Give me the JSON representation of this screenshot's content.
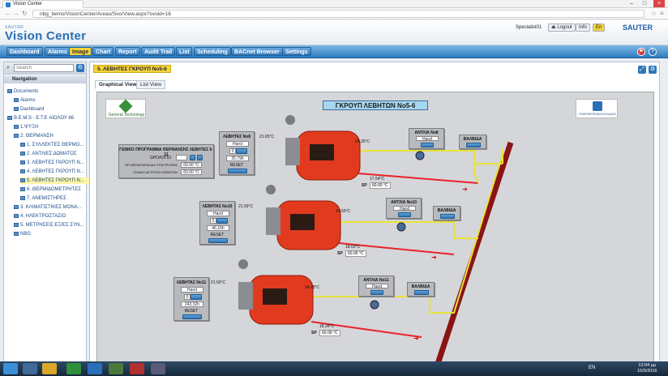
{
  "browser": {
    "tab_title": "Vision Center",
    "url": "nbg_bems/VisionCenter/Areas/Svo/View.aspx?svoid=18"
  },
  "header": {
    "brand_small": "SAUTER",
    "brand_big": "Vision Center",
    "user": "Specialist01",
    "logout": "Logout",
    "info": "Info",
    "lang": "En",
    "company": "SAUTER"
  },
  "menu": [
    "Dashboard",
    "Alarms",
    "Image",
    "Chart",
    "Report",
    "Audit Trail",
    "List",
    "Scheduling",
    "BACnet Browser",
    "Settings"
  ],
  "sidebar": {
    "search_placeholder": "Search",
    "nav_title": "Navigation",
    "items": [
      "Documents",
      "Alarms",
      "Dashboard",
      "B.E.M.S - E.T.E ΑΙΟΛΟΥ 86",
      "1.ΨΥΞΗ",
      "2. ΘΕΡΜΑΝΣΗ",
      "1. ΣΥΛΛΕΚΤΕΣ ΘΕΡΜΟ...",
      "2. ΑΝΤΛΙΕΣ ΔΩΜΑΤΟΣ",
      "3. ΛΕΒΗΤΕΣ ΓΚΡΟΥΠ Ν...",
      "4. ΛΕΒΗΤΕΣ ΓΚΡΟΥΠ Ν...",
      "5. ΛΕΒΗΤΕΣ ΓΚΡΟΥΠ Ν...",
      "6. ΘΕΡΜΙΔΟΜΕΤΡΗΤΕΣ",
      "7. ΑΝΕΜΙΣΤΗΡΕΣ",
      "3. ΚΛΙΜΑΤΙΣΤΙΚΕΣ ΜΟΝΑ...",
      "4. ΗΛΕΚΤΡΟΣΤΑΣΙΟ",
      "5. ΜΕΤΡΗΣΕΙΣ ΕΞ/ΕΣ ΣΥΝ...",
      "NBG"
    ]
  },
  "content": {
    "page_title": "5. ΛΕΒΗΤΕΣ ΓΚΡΟΥΠ Νο5-6",
    "tabs": [
      "Graphical View",
      "List View"
    ],
    "diagram_title": "ΓΚΡΟΥΠ ΛΕΒΗΤΩΝ Νο5-6",
    "logo_left": "General Technology",
    "logo_right": "ΠΛΗΡΟΦΟΡΙΑΚΗ ΕΛΛΑΔΟΣ",
    "program_panel": {
      "title": "ΓΕΝΙΚΟ ΠΡΟΓΡΑΜΜΑ ΘΕΡΜΑΝΣΗΣ ΛΕΒΗΤΕΣ 5-11",
      "rows": [
        "ΩΡΟΛΟΓΙΟ",
        "SP ΘΕΡΜΟΚΡΑΣΙΑΣ ΕΠΙΣΤΡΟΦΗΣ",
        "ΓΕΝΙΚΟ ΔΕΤΡΟΠΗ ΛΕΒΗΤΩΝ"
      ],
      "values": [
        "",
        "60.00 °C",
        "60.00 °C"
      ]
    },
    "boilers": [
      {
        "name": "ΛΕΒΗΤΑΣ Νο8",
        "mode": "Hand",
        "state": "0",
        "hours": "25.79h",
        "reset": "RESET",
        "t_in": "21.65°C",
        "t_out": "24.26°C",
        "t_ret": "17.54°C",
        "sp": "60.00 °C",
        "pump": "ΑΝΤΛΙΑ Νο8",
        "pump_mode": "Hand",
        "valve": "ΒΑΛΒΙΔΑ"
      },
      {
        "name": "ΛΕΒΗΤΑΣ Νο10",
        "mode": "Hand",
        "state": "0",
        "hours": "46.16h",
        "reset": "RESET",
        "t_in": "21.59°C",
        "t_out": "24.55°C",
        "t_ret": "18.50°C",
        "sp": "60.00 °C",
        "pump": "ΑΝΤΛΙΑ Νο10",
        "pump_mode": "Hand",
        "valve": "ΒΑΛΒΙΔΑ"
      },
      {
        "name": "ΛΕΒΗΤΑΣ Νο11",
        "mode": "Hand",
        "state": "0",
        "hours": "243.32h",
        "reset": "RESET",
        "t_in": "21.69°C",
        "t_out": "24.28°C",
        "t_ret": "18.34°C",
        "sp": "60.00 °C",
        "pump": "ΑΝΤΛΙΑ Νο11",
        "pump_mode": "Hand",
        "valve": "ΒΑΛΒΙΔΑ"
      }
    ]
  },
  "taskbar": {
    "lang": "EN",
    "time": "12:04 μμ",
    "date": "15/9/2016"
  }
}
